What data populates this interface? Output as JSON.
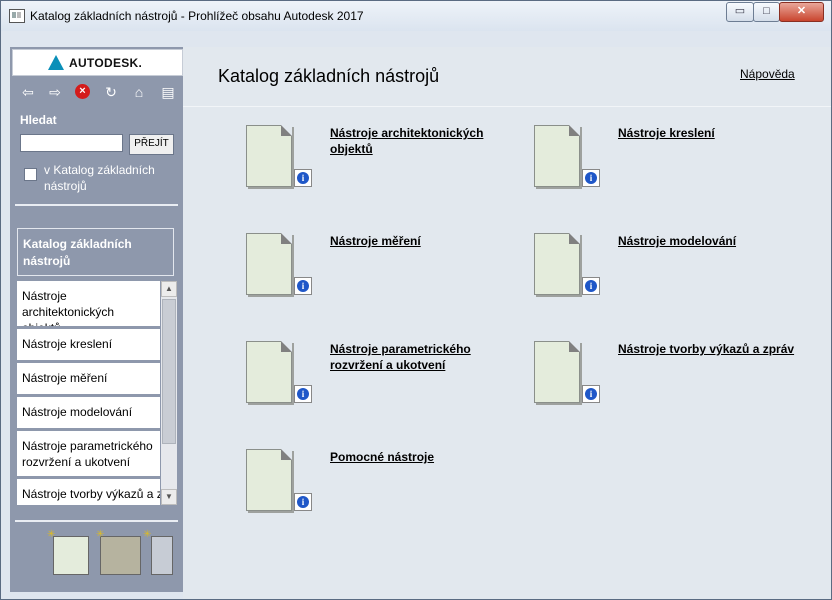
{
  "window": {
    "title": "Katalog základních nástrojů - Prohlížeč obsahu Autodesk 2017",
    "min_glyph": "▭",
    "max_glyph": "□",
    "close_glyph": "✕"
  },
  "sidebar": {
    "logo_text": "AUTODESK.",
    "toolbar": {
      "back_glyph": "⇦",
      "forward_glyph": "⇨",
      "stop_glyph": "×",
      "refresh_glyph": "↻",
      "home_glyph": "⌂",
      "print_glyph": "▤"
    },
    "search": {
      "label": "Hledat",
      "value": "",
      "go_label": "PŘEJÍT",
      "scope_label": "v Katalog základních nástrojů",
      "scope_checked": false
    },
    "nav_header": "Katalog základních nástrojů",
    "nav_items": [
      "Nástroje architektonických objektů",
      "Nástroje kreslení",
      "Nástroje měření",
      "Nástroje modelování",
      "Nástroje parametrického rozvržení a ukotvení",
      "Nástroje tvorby výkazů a zpráv"
    ]
  },
  "main": {
    "title": "Katalog základních nástrojů",
    "help_link": "Nápověda",
    "tools": [
      {
        "label": "Nástroje architektonických objektů"
      },
      {
        "label": "Nástroje kreslení"
      },
      {
        "label": "Nástroje měření"
      },
      {
        "label": "Nástroje modelování"
      },
      {
        "label": "Nástroje parametrického rozvržení a ukotvení"
      },
      {
        "label": "Nástroje tvorby výkazů a zpráv"
      },
      {
        "label": "Pomocné nástroje"
      }
    ]
  },
  "colors": {
    "sidebar_bg": "#8e98ac",
    "main_bg": "#e2e8ee",
    "info_blue": "#1f57c8",
    "close_red": "#c9452e"
  }
}
